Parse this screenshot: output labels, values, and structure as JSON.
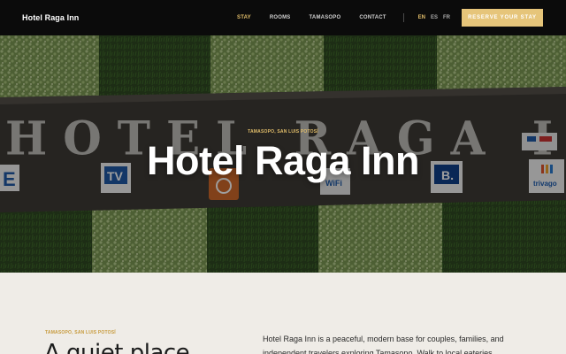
{
  "header": {
    "brand": "Hotel Raga Inn",
    "nav": [
      {
        "label": "STAY",
        "active": true
      },
      {
        "label": "ROOMS",
        "active": false
      },
      {
        "label": "TAMASOPO",
        "active": false
      },
      {
        "label": "CONTACT",
        "active": false
      }
    ],
    "languages": [
      {
        "label": "EN",
        "active": true
      },
      {
        "label": "ES",
        "active": false
      },
      {
        "label": "FR",
        "active": false
      }
    ],
    "reserve_label": "RESERVE YOUR STAY"
  },
  "hero": {
    "eyebrow": "TAMASOPO, SAN LUIS POTOSÍ",
    "title": "Hotel Raga Inn",
    "sign_text": "HOTEL RAGA INN",
    "badges": [
      "E",
      "TV",
      "WiFi",
      "B.",
      "trivago"
    ]
  },
  "intro": {
    "eyebrow": "TAMASOPO, SAN LUIS POTOSÍ",
    "heading": "A quiet place",
    "text": "Hotel Raga Inn is a peaceful, modern base for couples, families, and independent travelers exploring Tamasopo. Walk to local eateries"
  },
  "colors": {
    "header_bg": "#0b0b0b",
    "accent": "#e2be6a",
    "reserve_bg": "#e6c57a",
    "page_bg": "#efece7"
  }
}
